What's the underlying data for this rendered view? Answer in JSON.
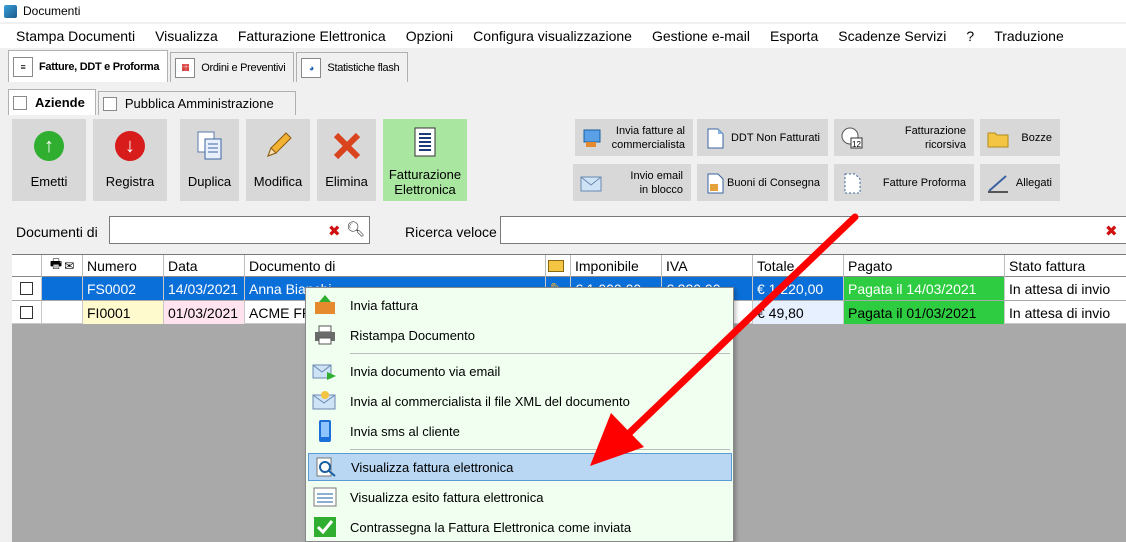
{
  "window": {
    "title": "Documenti"
  },
  "menu": [
    "Stampa Documenti",
    "Visualizza",
    "Fatturazione Elettronica",
    "Opzioni",
    "Configura visualizzazione",
    "Gestione e-mail",
    "Esporta",
    "Scadenze Servizi",
    "?",
    "Traduzione"
  ],
  "top_tabs": [
    "Fatture, DDT e Proforma",
    "Ordini e Preventivi",
    "Statistiche flash"
  ],
  "sub_tabs": [
    "Aziende",
    "Pubblica Amministrazione"
  ],
  "toolbar": {
    "emetti": "Emetti",
    "registra": "Registra",
    "duplica": "Duplica",
    "modifica": "Modifica",
    "elimina": "Elimina",
    "fatturazione_line1": "Fatturazione",
    "fatturazione_line2": "Elettronica",
    "invia_commercialista_1": "Invia fatture al",
    "invia_commercialista_2": "commercialista",
    "invio_email_1": "Invio email",
    "invio_email_2": "in blocco",
    "ddt_non_fatturati": "DDT Non Fatturati",
    "buoni_consegna": "Buoni di Consegna",
    "fatturazione_ricorsiva": "Fatturazione ricorsiva",
    "fatture_proforma": "Fatture Proforma",
    "bozze": "Bozze",
    "allegati": "Allegati"
  },
  "search": {
    "documenti_label": "Documenti di",
    "ricerca_label": "Ricerca veloce",
    "documenti_value": "",
    "ricerca_value": ""
  },
  "table": {
    "headers": [
      "Numero",
      "Data",
      "Documento di",
      "Imponibile",
      "IVA",
      "Totale",
      "Pagato",
      "Stato fattura"
    ],
    "rows": [
      {
        "numero": "FS0002",
        "data": "14/03/2021",
        "documento_di": "Anna Bianchi",
        "imponibile": "€ 1.000,00",
        "iva": "€ 220,00",
        "totale": "€ 1.220,00",
        "pagato": "Pagata il 14/03/2021",
        "stato": "In attesa di invio"
      },
      {
        "numero": "FI0001",
        "data": "01/03/2021",
        "documento_di": "ACME FP",
        "imponibile": "",
        "iva": "",
        "totale": "€ 49,80",
        "pagato": "Pagata il 01/03/2021",
        "stato": "In attesa di invio"
      }
    ]
  },
  "context_menu": [
    "Invia fattura",
    "Ristampa Documento",
    "Invia documento via email",
    "Invia al commercialista il file XML del documento",
    "Invia sms al cliente",
    "Visualizza fattura elettronica",
    "Visualizza esito fattura elettronica",
    "Contrassegna la Fattura Elettronica come inviata"
  ],
  "colors": {
    "selected_row": "#0a6fd8",
    "paid_green": "#2ecc40",
    "context_bg": "#f0fff0",
    "highlight": "#b9d6f2",
    "arrow": "#ff0000"
  }
}
